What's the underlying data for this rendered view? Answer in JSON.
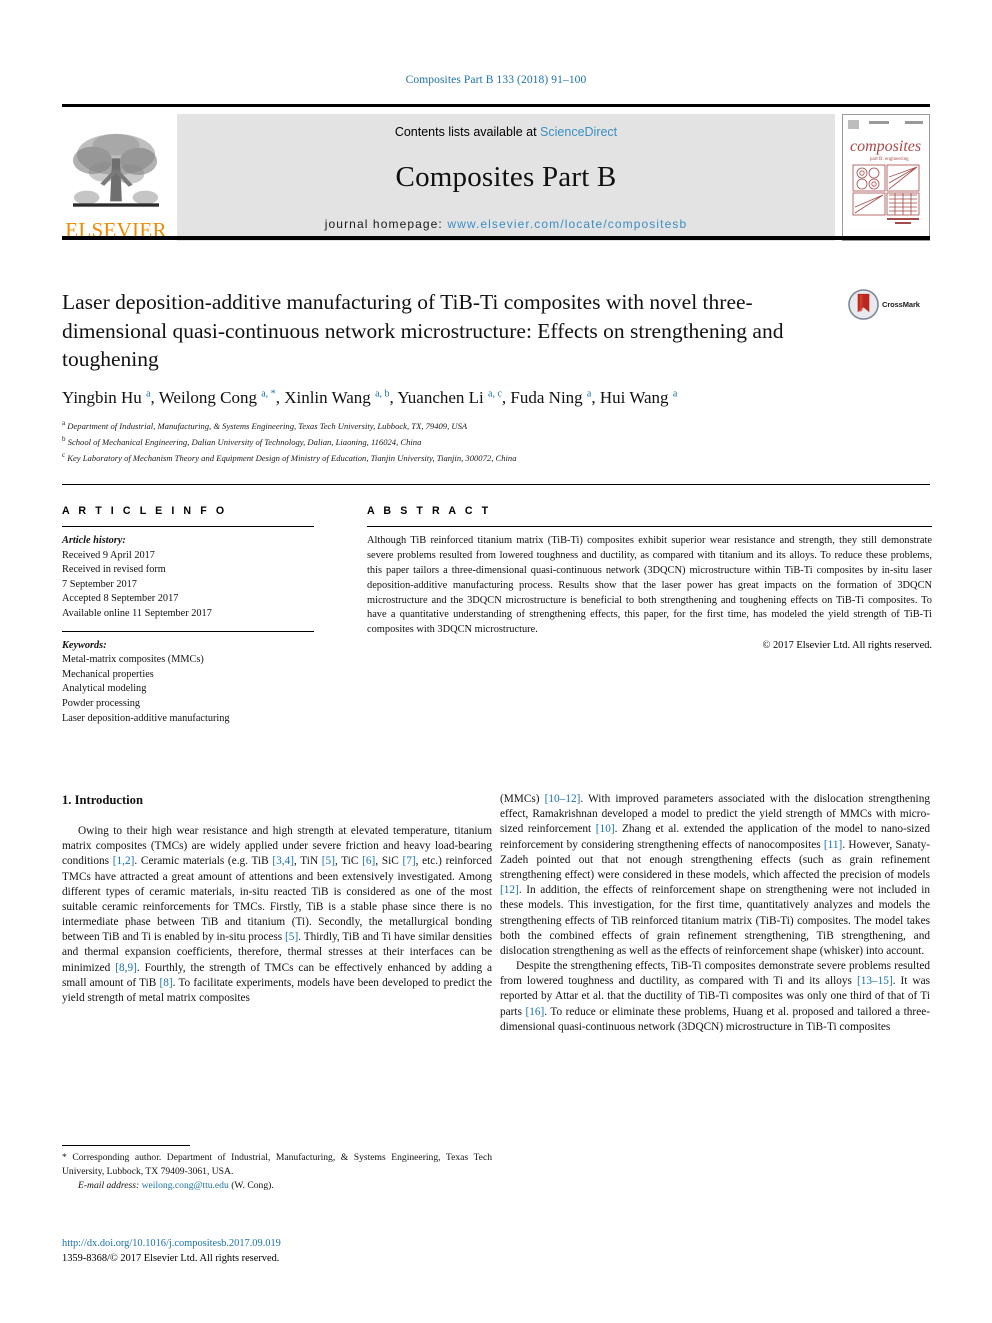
{
  "running_head": "Composites Part B 133 (2018) 91–100",
  "masthead": {
    "publisher_logo_text": "ELSEVIER",
    "contents_prefix": "Contents lists available at ",
    "contents_link": "ScienceDirect",
    "journal_title": "Composites Part B",
    "homepage_label": "journal homepage: ",
    "homepage_url": "www.elsevier.com/locate/compositesb",
    "cover_title": "composites",
    "cover_subtitle": "part B: engineering"
  },
  "article": {
    "title": "Laser deposition-additive manufacturing of TiB-Ti composites with novel three-dimensional quasi-continuous network microstructure: Effects on strengthening and toughening",
    "crossmark_label": "CrossMark",
    "authors_html": "Yingbin Hu <sup>a</sup>, Weilong Cong <sup>a, *</sup>, Xinlin Wang <sup>a, b</sup>, Yuanchen Li <sup>a, c</sup>, Fuda Ning <sup>a</sup>, Hui Wang <sup>a</sup>",
    "affiliations": [
      {
        "mark": "a",
        "text": "Department of Industrial, Manufacturing, & Systems Engineering, Texas Tech University, Lubbock, TX, 79409, USA"
      },
      {
        "mark": "b",
        "text": "School of Mechanical Engineering, Dalian University of Technology, Dalian, Liaoning, 116024, China"
      },
      {
        "mark": "c",
        "text": "Key Laboratory of Mechanism Theory and Equipment Design of Ministry of Education, Tianjin University, Tianjin, 300072, China"
      }
    ]
  },
  "article_info": {
    "heading": "A R T I C L E  I N F O",
    "history_label": "Article history:",
    "history_lines": [
      "Received 9 April 2017",
      "Received in revised form",
      "7 September 2017",
      "Accepted 8 September 2017",
      "Available online 11 September 2017"
    ],
    "keywords_label": "Keywords:",
    "keywords": [
      "Metal-matrix composites (MMCs)",
      "Mechanical properties",
      "Analytical modeling",
      "Powder processing",
      "Laser deposition-additive manufacturing"
    ]
  },
  "abstract": {
    "heading": "A B S T R A C T",
    "body": "Although TiB reinforced titanium matrix (TiB-Ti) composites exhibit superior wear resistance and strength, they still demonstrate severe problems resulted from lowered toughness and ductility, as compared with titanium and its alloys. To reduce these problems, this paper tailors a three-dimensional quasi-continuous network (3DQCN) microstructure within TiB-Ti composites by in-situ laser deposition-additive manufacturing process. Results show that the laser power has great impacts on the formation of 3DQCN microstructure and the 3DQCN microstructure is beneficial to both strengthening and toughening effects on TiB-Ti composites. To have a quantitative understanding of strengthening effects, this paper, for the first time, has modeled the yield strength of TiB-Ti composites with 3DQCN microstructure.",
    "copyright": "© 2017 Elsevier Ltd. All rights reserved."
  },
  "introduction": {
    "heading": "1. Introduction",
    "left_column_html": "<p>Owing to their high wear resistance and high strength at elevated temperature, titanium matrix composites (TMCs) are widely applied under severe friction and heavy load-bearing conditions <span class=\"ref\">[1,2]</span>. Ceramic materials (e.g. TiB <span class=\"ref\">[3,4]</span>, TiN <span class=\"ref\">[5]</span>, TiC <span class=\"ref\">[6]</span>, SiC <span class=\"ref\">[7]</span>, etc.) reinforced TMCs have attracted a great amount of attentions and been extensively investigated. Among different types of ceramic materials, in-situ reacted TiB is considered as one of the most suitable ceramic reinforcements for TMCs. Firstly, TiB is a stable phase since there is no intermediate phase between TiB and titanium (Ti). Secondly, the metallurgical bonding between TiB and Ti is enabled by in-situ process <span class=\"ref\">[5]</span>. Thirdly, TiB and Ti have similar densities and thermal expansion coefficients, therefore, thermal stresses at their interfaces can be minimized <span class=\"ref\">[8,9]</span>. Fourthly, the strength of TMCs can be effectively enhanced by adding a small amount of TiB <span class=\"ref\">[8]</span>. To facilitate experiments, models have been developed to predict the yield strength of metal matrix composites</p>",
    "right_column_html": "<p class=\"noind\">(MMCs) <span class=\"ref\">[10–12]</span>. With improved parameters associated with the dislocation strengthening effect, Ramakrishnan developed a model to predict the yield strength of MMCs with micro-sized reinforcement <span class=\"ref\">[10]</span>. Zhang et al. extended the application of the model to nano-sized reinforcement by considering strengthening effects of nanocomposites <span class=\"ref\">[11]</span>. However, Sanaty-Zadeh pointed out that not enough strengthening effects (such as grain refinement strengthening effect) were considered in these models, which affected the precision of models <span class=\"ref\">[12]</span>. In addition, the effects of reinforcement shape on strengthening were not included in these models. This investigation, for the first time, quantitatively analyzes and models the strengthening effects of TiB reinforced titanium matrix (TiB-Ti) composites. The model takes both the combined effects of grain refinement strengthening, TiB strengthening, and dislocation strengthening as well as the effects of reinforcement shape (whisker) into account.</p><p>Despite the strengthening effects, TiB-Ti composites demonstrate severe problems resulted from lowered toughness and ductility, as compared with Ti and its alloys <span class=\"ref\">[13–15]</span>. It was reported by Attar et al. that the ductility of TiB-Ti composites was only one third of that of Ti parts <span class=\"ref\">[16]</span>. To reduce or eliminate these problems, Huang et al. proposed and tailored a three-dimensional quasi-continuous network (3DQCN) microstructure in TiB-Ti composites</p>"
  },
  "footnote": {
    "corresponding": "* Corresponding author. Department of Industrial, Manufacturing, & Systems Engineering, Texas Tech University, Lubbock, TX 79409-3061, USA.",
    "email_label": "E-mail address:",
    "email_address": "weilong.cong@ttu.edu",
    "email_suffix": "(W. Cong)."
  },
  "doi_block": {
    "doi_url": "http://dx.doi.org/10.1016/j.compositesb.2017.09.019",
    "issn_line": "1359-8368/© 2017 Elsevier Ltd. All rights reserved."
  },
  "colors": {
    "link": "#1b72a8",
    "elsevier_orange": "#f08a00",
    "banner_bg": "#e3e3e3",
    "cover_red": "#a34a4a"
  }
}
